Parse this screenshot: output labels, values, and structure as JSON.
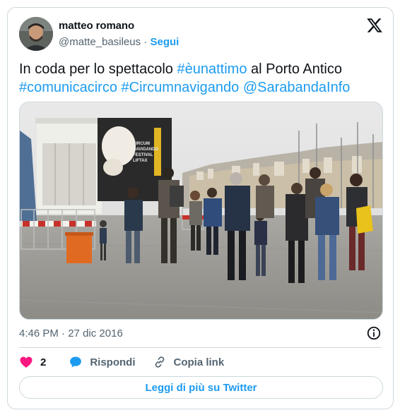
{
  "author": {
    "name": "matteo romano",
    "handle": "@matte_basileus",
    "separator": "·",
    "follow_label": "Segui"
  },
  "tweet": {
    "parts": [
      {
        "text": "In coda per lo spettacolo ",
        "link": false
      },
      {
        "text": "#èunattimo",
        "link": true
      },
      {
        "text": " al Porto Antico",
        "link": false
      },
      {
        "text": "#comunicacirco",
        "link": true
      },
      {
        "text": " ",
        "link": false
      },
      {
        "text": "#Circumnavigando",
        "link": true
      },
      {
        "text": " ",
        "link": false
      },
      {
        "text": "@SarabandaInfo",
        "link": true
      }
    ]
  },
  "media": {
    "poster_lines": [
      "CIRCUM",
      "NAVIGANDO",
      "FESTIVAL",
      "LIFTAX"
    ]
  },
  "meta": {
    "time": "4:46 PM",
    "separator": "·",
    "date": "27 dic 2016"
  },
  "actions": {
    "like_count": "2",
    "reply_label": "Rispondi",
    "copy_label": "Copia link"
  },
  "read_more_label": "Leggi di più su Twitter",
  "colors": {
    "link": "#1d9bf0",
    "heart": "#f91880",
    "border": "#cfd9de",
    "secondary_text": "#536471"
  },
  "icons": {
    "close": "x-logo-icon",
    "info": "info-icon",
    "like": "heart-icon",
    "reply": "reply-bubble-icon",
    "copy": "link-icon"
  }
}
